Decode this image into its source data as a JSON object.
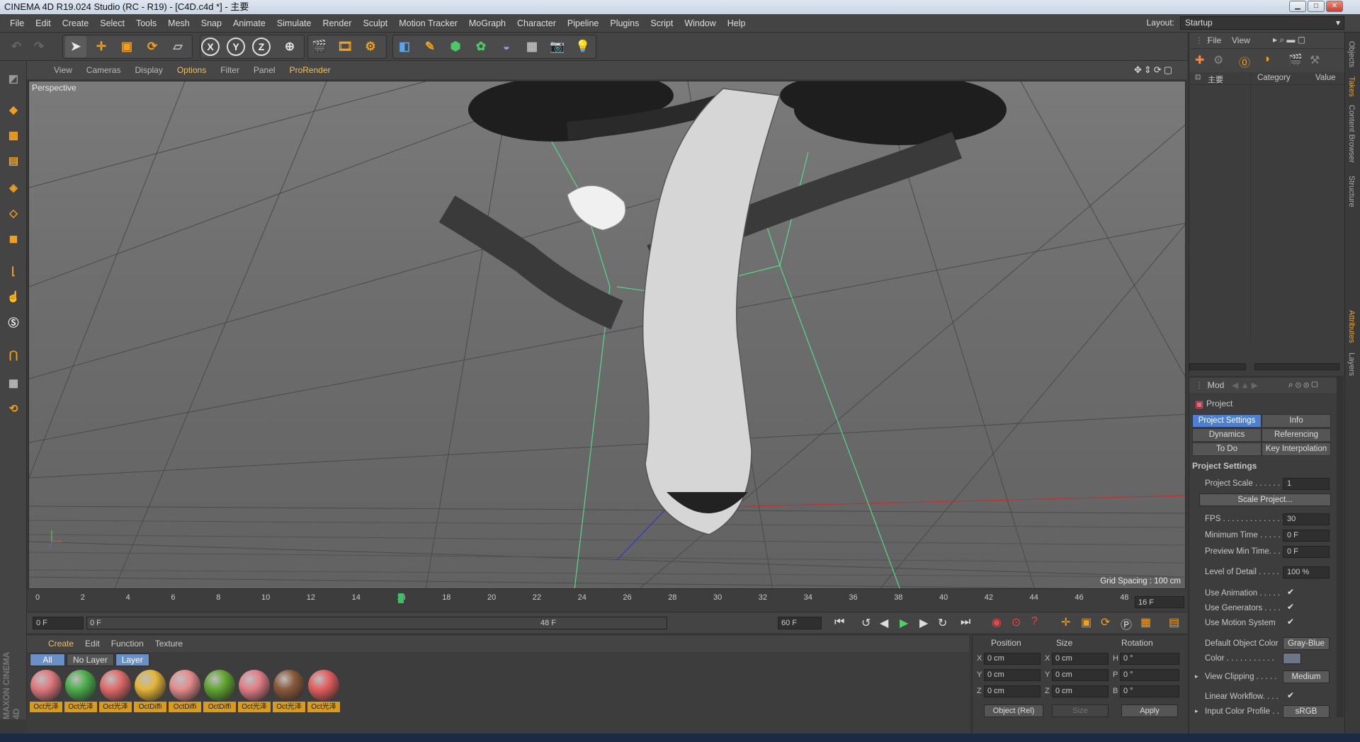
{
  "window": {
    "title": "CINEMA 4D R19.024 Studio (RC - R19) - [C4D.c4d *] - 主要"
  },
  "menu": [
    "File",
    "Edit",
    "Create",
    "Select",
    "Tools",
    "Mesh",
    "Snap",
    "Animate",
    "Simulate",
    "Render",
    "Sculpt",
    "Motion Tracker",
    "MoGraph",
    "Character",
    "Pipeline",
    "Plugins",
    "Script",
    "Window",
    "Help"
  ],
  "layout": {
    "label": "Layout:",
    "value": "Startup"
  },
  "viewport": {
    "menu": [
      "View",
      "Cameras",
      "Display",
      "Options",
      "Filter",
      "Panel",
      "ProRender"
    ],
    "label": "Perspective",
    "grid_spacing": "Grid Spacing : 100 cm"
  },
  "timeline": {
    "ticks": [
      "0",
      "2",
      "4",
      "6",
      "8",
      "10",
      "12",
      "14",
      "16",
      "18",
      "20",
      "22",
      "24",
      "26",
      "28",
      "30",
      "32",
      "34",
      "36",
      "38",
      "40",
      "42",
      "44",
      "46",
      "48"
    ],
    "current_frame": "16 F",
    "start": "0 F",
    "range_start": "0 F",
    "range_end": "48 F",
    "end": "60 F"
  },
  "materials": {
    "menu": [
      "Create",
      "Edit",
      "Function",
      "Texture"
    ],
    "tabs": [
      "All",
      "No Layer",
      "Layer"
    ],
    "items": [
      {
        "label": "Oct光泽",
        "color": "#e07a7e"
      },
      {
        "label": "Oct光泽",
        "color": "#4cae4c"
      },
      {
        "label": "Oct光泽",
        "color": "#e06b6b"
      },
      {
        "label": "OctDiffi",
        "color": "#e3b53a"
      },
      {
        "label": "OctDiffi",
        "color": "#e58c8c"
      },
      {
        "label": "OctDiffi",
        "color": "#62a532"
      },
      {
        "label": "Oct光泽",
        "color": "#e07e86"
      },
      {
        "label": "Oct光泽",
        "color": "#8a5a3a"
      },
      {
        "label": "Oct光泽",
        "color": "#e25f5f"
      }
    ]
  },
  "coords": {
    "headers": [
      "Position",
      "Size",
      "Rotation"
    ],
    "rows": [
      {
        "a": "X",
        "pos": "0 cm",
        "b": "X",
        "size": "0 cm",
        "c": "H",
        "rot": "0 °"
      },
      {
        "a": "Y",
        "pos": "0 cm",
        "b": "Y",
        "size": "0 cm",
        "c": "P",
        "rot": "0 °"
      },
      {
        "a": "Z",
        "pos": "0 cm",
        "b": "Z",
        "size": "0 cm",
        "c": "B",
        "rot": "0 °"
      }
    ],
    "mode": "Object (Rel)",
    "size_mode": "Size",
    "apply": "Apply"
  },
  "objects": {
    "menu": [
      "File",
      "View"
    ],
    "tree_item": "主要",
    "col_category": "Category",
    "col_value": "Value"
  },
  "attributes": {
    "menu": "Mod",
    "title": "Project",
    "tabs": [
      "Project Settings",
      "Info",
      "Dynamics",
      "Referencing",
      "To Do",
      "Key Interpolation"
    ],
    "section": "Project Settings",
    "project_scale_label": "Project Scale . . . . . .",
    "project_scale": "1",
    "scale_button": "Scale Project...",
    "fps_label": "FPS . . . . . . . . . . . . . . .",
    "fps": "30",
    "min_time_label": "Minimum Time . . . . .",
    "min_time": "0 F",
    "preview_min_label": "Preview Min Time. . .",
    "preview_min": "0 F",
    "lod_label": "Level of Detail . . . . .",
    "lod": "100 %",
    "use_animation": "Use Animation . . . . .",
    "use_generators": "Use Generators . . . .",
    "use_motion": "Use Motion System",
    "default_color_label": "Default Object Color",
    "default_color": "Gray-Blue",
    "color_label": "Color . . . . . . . . . . .",
    "view_clipping_label": "View Clipping . . . . .",
    "view_clipping": "Medium",
    "linear_workflow": "Linear Workflow. . . .",
    "input_profile_label": "Input Color Profile . .",
    "input_profile": "sRGB"
  },
  "side_tabs": [
    "Objects",
    "Takes",
    "Content Browser",
    "Structure",
    "Attributes",
    "Layers"
  ],
  "brand": "MAXON CINEMA 4D"
}
